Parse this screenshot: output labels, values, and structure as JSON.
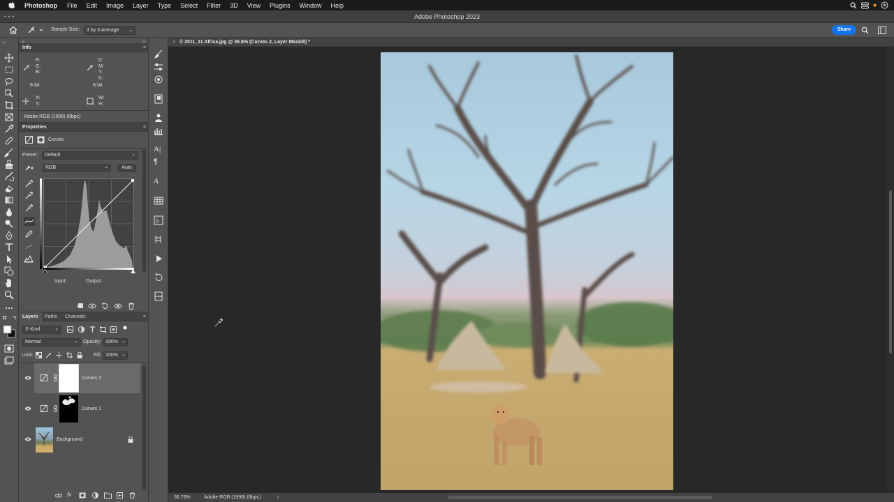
{
  "menubar": {
    "app": "Photoshop",
    "items": [
      "File",
      "Edit",
      "Image",
      "Layer",
      "Type",
      "Select",
      "Filter",
      "3D",
      "View",
      "Plugins",
      "Window",
      "Help"
    ]
  },
  "window": {
    "title": "Adobe Photoshop 2023"
  },
  "options": {
    "sample_label": "Sample Size:",
    "sample_value": "3 by 3 Average",
    "share_label": "Share"
  },
  "info_panel": {
    "title": "Info",
    "rgb_labels": "R:\nG:\nB:",
    "cmyk_labels": "C:\nM:\nY:\nK:",
    "bit_left": "8-bit",
    "bit_right": "8-bit",
    "xy_labels": "X:\nY:",
    "wh_labels": "W:\nH:",
    "profile": "Adobe RGB (1998) (8bpc)"
  },
  "properties_panel": {
    "title": "Properties",
    "adjustment": "Curves",
    "preset_label": "Preset:",
    "preset_value": "Default",
    "channel_value": "RGB",
    "auto_label": "Auto",
    "input_label": "Input:",
    "output_label": "Output:"
  },
  "layers_panel": {
    "tabs": [
      "Layers",
      "Paths",
      "Channels"
    ],
    "kind_label": "Kind",
    "blend_mode": "Normal",
    "opacity_label": "Opacity:",
    "opacity_value": "100%",
    "lock_label": "Lock:",
    "fill_label": "Fill:",
    "fill_value": "100%",
    "layers": [
      {
        "name": "Curves 2",
        "selected": true
      },
      {
        "name": "Curves 1",
        "selected": false
      },
      {
        "name": "Background",
        "selected": false
      }
    ]
  },
  "document": {
    "tab_title": "© 2011_11 Africa.jpg @ 36.8% (Curves 2, Layer Mask/8) *",
    "zoom": "36.76%",
    "status_profile": "Adobe RGB (1998) (8bpc)"
  },
  "colors": {
    "accent": "#1473e6",
    "panel": "#535353",
    "panel_dark": "#434343",
    "canvas": "#282828"
  }
}
